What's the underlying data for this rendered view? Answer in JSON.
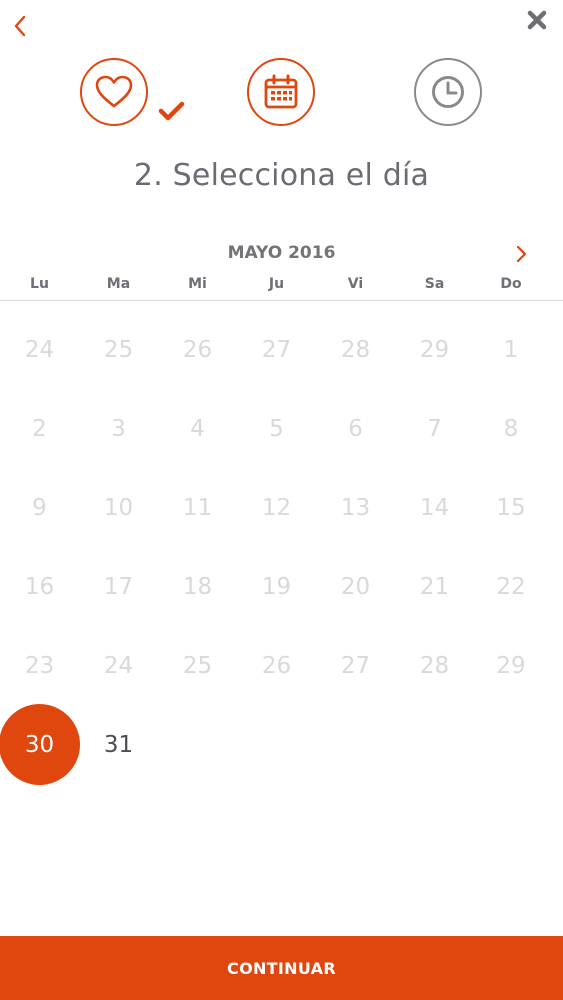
{
  "title": "2. Selecciona el día",
  "month": "MAYO 2016",
  "weekdays": [
    "Lu",
    "Ma",
    "Mi",
    "Ju",
    "Vi",
    "Sa",
    "Do"
  ],
  "weeks": [
    [
      "24",
      "25",
      "26",
      "27",
      "28",
      "29",
      "1"
    ],
    [
      "2",
      "3",
      "4",
      "5",
      "6",
      "7",
      "8"
    ],
    [
      "9",
      "10",
      "11",
      "12",
      "13",
      "14",
      "15"
    ],
    [
      "16",
      "17",
      "18",
      "19",
      "20",
      "21",
      "22"
    ],
    [
      "23",
      "24",
      "25",
      "26",
      "27",
      "28",
      "29"
    ],
    [
      "30",
      "31",
      "",
      "",
      "",
      "",
      ""
    ]
  ],
  "selected_day": "30",
  "available_days": [
    "30",
    "31"
  ],
  "continue_label": "CONTINUAR",
  "icons": {
    "back": "chevron-left-icon",
    "close": "close-icon",
    "step1": "heart-icon",
    "step1_done": "checkmark-icon",
    "step2": "calendar-icon",
    "step3": "clock-icon",
    "next": "chevron-right-icon"
  },
  "colors": {
    "accent": "#e0470f",
    "inactive": "#8a8a8a",
    "text": "#4d4d52",
    "muted": "#d9d9dd"
  }
}
